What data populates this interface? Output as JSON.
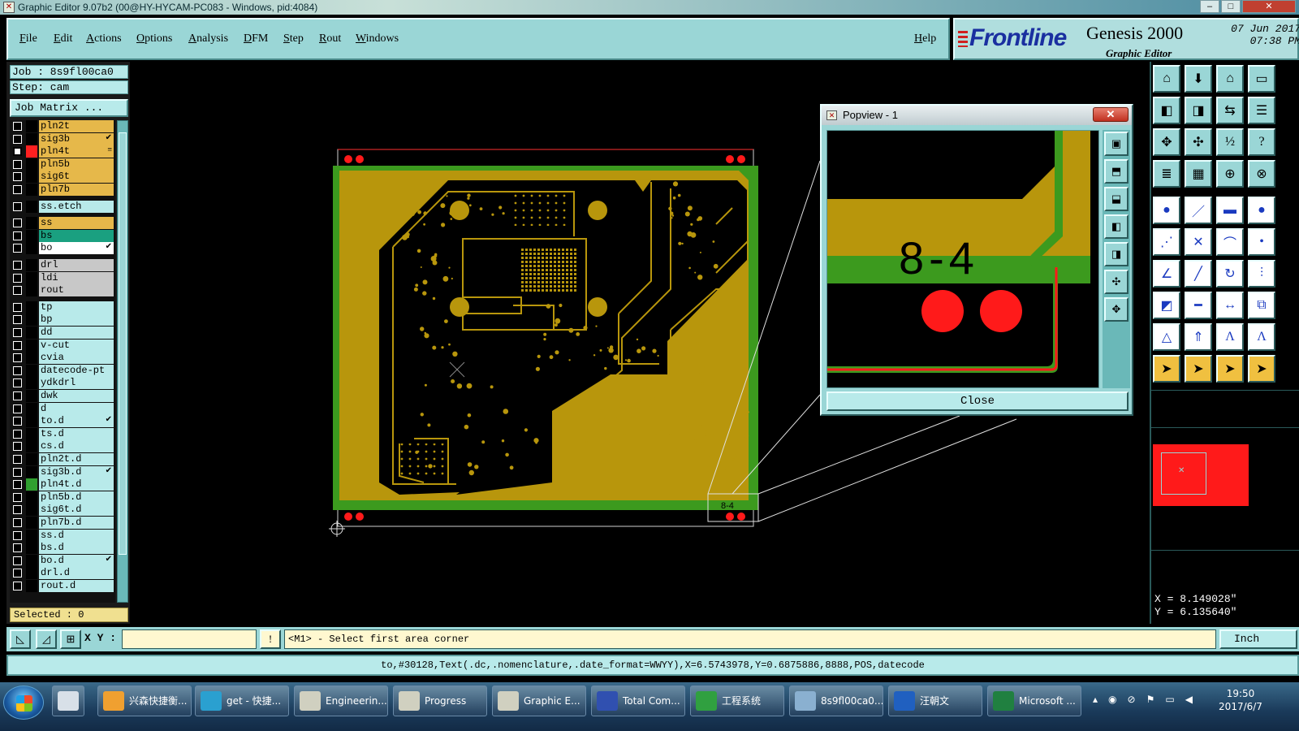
{
  "window": {
    "title": "Graphic Editor 9.07b2 (00@HY-HYCAM-PC083 - Windows, pid:4084)"
  },
  "menu": {
    "items": [
      "File",
      "Edit",
      "Actions",
      "Options",
      "Analysis",
      "DFM",
      "Step",
      "Rout",
      "Windows"
    ],
    "help": "Help"
  },
  "brand": {
    "logo": "Frontline",
    "product": "Genesis 2000",
    "subtitle": "Graphic Editor",
    "date": "07 Jun 2017",
    "time": "07:38 PM"
  },
  "job": {
    "job_label": "Job : 8s9fl00ca0",
    "step_label": "Step: cam",
    "matrix_button": "Job Matrix ...",
    "selected": "Selected : 0"
  },
  "layers": [
    {
      "name": "pln2t",
      "color": "#e6b84a",
      "mark": ""
    },
    {
      "name": "sig3b",
      "color": "#e6b84a",
      "mark": "✔"
    },
    {
      "name": "pln4t",
      "color": "#e6b84a",
      "mark": "≡",
      "swatch": "#ff2020",
      "active": true
    },
    {
      "name": "pln5b",
      "color": "#e6b84a",
      "mark": ""
    },
    {
      "name": "sig6t",
      "color": "#e6b84a",
      "mark": ""
    },
    {
      "name": "pln7b",
      "color": "#e6b84a",
      "mark": ""
    },
    {
      "gap": true
    },
    {
      "name": "ss.etch",
      "color": "#b8eaea",
      "mark": ""
    },
    {
      "gap": true
    },
    {
      "name": "ss",
      "color": "#e6b84a",
      "mark": ""
    },
    {
      "name": "bs",
      "color": "#1aa080",
      "mark": ""
    },
    {
      "name": "bo",
      "color": "#ffffff",
      "mark": "✔"
    },
    {
      "gap": true
    },
    {
      "name": "drl",
      "color": "#c8c8c8",
      "mark": ""
    },
    {
      "name": "ldi",
      "color": "#c8c8c8",
      "mark": ""
    },
    {
      "name": "rout",
      "color": "#c8c8c8",
      "mark": ""
    },
    {
      "gap": true
    },
    {
      "name": "tp",
      "color": "#b8eaea",
      "mark": ""
    },
    {
      "name": "bp",
      "color": "#b8eaea",
      "mark": ""
    },
    {
      "name": "dd",
      "color": "#b8eaea",
      "mark": ""
    },
    {
      "name": "v-cut",
      "color": "#b8eaea",
      "mark": ""
    },
    {
      "name": "cvia",
      "color": "#b8eaea",
      "mark": ""
    },
    {
      "name": "datecode-pt",
      "color": "#b8eaea",
      "mark": ""
    },
    {
      "name": "ydkdrl",
      "color": "#b8eaea",
      "mark": ""
    },
    {
      "name": "dwk",
      "color": "#b8eaea",
      "mark": ""
    },
    {
      "name": "d",
      "color": "#b8eaea",
      "mark": ""
    },
    {
      "name": "to.d",
      "color": "#b8eaea",
      "mark": "✔"
    },
    {
      "name": "ts.d",
      "color": "#b8eaea",
      "mark": ""
    },
    {
      "name": "cs.d",
      "color": "#b8eaea",
      "mark": ""
    },
    {
      "name": "pln2t.d",
      "color": "#b8eaea",
      "mark": ""
    },
    {
      "name": "sig3b.d",
      "color": "#b8eaea",
      "mark": "✔"
    },
    {
      "name": "pln4t.d",
      "color": "#b8eaea",
      "mark": "",
      "swatch": "#30a030"
    },
    {
      "name": "pln5b.d",
      "color": "#b8eaea",
      "mark": ""
    },
    {
      "name": "sig6t.d",
      "color": "#b8eaea",
      "mark": ""
    },
    {
      "name": "pln7b.d",
      "color": "#b8eaea",
      "mark": ""
    },
    {
      "name": "ss.d",
      "color": "#b8eaea",
      "mark": ""
    },
    {
      "name": "bs.d",
      "color": "#b8eaea",
      "mark": ""
    },
    {
      "name": "bo.d",
      "color": "#b8eaea",
      "mark": "✔"
    },
    {
      "name": "drl.d",
      "color": "#b8eaea",
      "mark": ""
    },
    {
      "name": "rout.d",
      "color": "#b8eaea",
      "mark": ""
    }
  ],
  "board": {
    "label": "8-4"
  },
  "popview": {
    "title": "Popview - 1",
    "close_x": "✕",
    "close_button": "Close",
    "zoom_label": "8-4"
  },
  "coords": {
    "x": "X = 8.149028\"",
    "y": "Y = 6.135640\""
  },
  "command": {
    "xy_label": "X Y :",
    "xy_value": "",
    "message": "<M1> - Select first area corner",
    "unit": "Inch",
    "status": "to,#30128,Text(.dc,.nomenclature,.date_format=WWYY),X=6.5743978,Y=0.6875886,8888,POS,datecode"
  },
  "taskbar": {
    "items": [
      {
        "label": "兴森快捷衡...",
        "icon_color": "#f0a030"
      },
      {
        "label": "get - 快捷...",
        "icon_color": "#2aa0d0"
      },
      {
        "label": "Engineerin...",
        "icon_color": "#d0d0c0"
      },
      {
        "label": "Progress",
        "icon_color": "#d0d0c0"
      },
      {
        "label": "Graphic E...",
        "icon_color": "#d0d0c0"
      },
      {
        "label": "Total Com...",
        "icon_color": "#3050b0"
      },
      {
        "label": "工程系统",
        "icon_color": "#30a040"
      },
      {
        "label": "8s9fl00ca0...",
        "icon_color": "#8ab0d0"
      },
      {
        "label": "汪朝文",
        "icon_color": "#2060c0"
      },
      {
        "label": "Microsoft ...",
        "icon_color": "#208040"
      }
    ],
    "time": "19:50",
    "date": "2017/6/7"
  },
  "colors": {
    "copper": "#b8960c",
    "soldermask_green": "#3c9a1e",
    "panel_cyan": "#9ad6d6",
    "drill_red": "#ff1a1a"
  }
}
